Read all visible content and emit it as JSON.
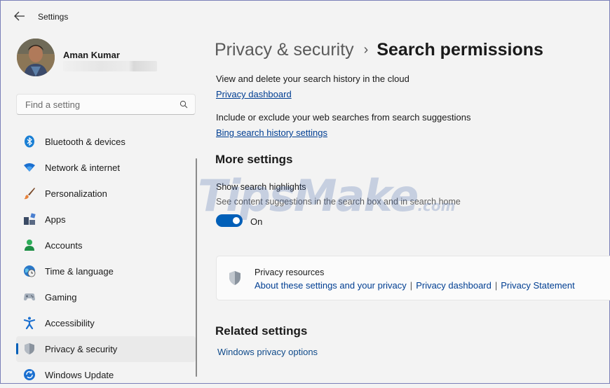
{
  "window": {
    "title": "Settings"
  },
  "profile": {
    "name": "Aman Kumar"
  },
  "search": {
    "placeholder": "Find a setting"
  },
  "sidebar": {
    "items": [
      {
        "label": "Bluetooth & devices",
        "icon": "bluetooth-icon"
      },
      {
        "label": "Network & internet",
        "icon": "wifi-icon"
      },
      {
        "label": "Personalization",
        "icon": "brush-icon"
      },
      {
        "label": "Apps",
        "icon": "apps-icon"
      },
      {
        "label": "Accounts",
        "icon": "person-icon"
      },
      {
        "label": "Time & language",
        "icon": "globe-clock-icon"
      },
      {
        "label": "Gaming",
        "icon": "gamepad-icon"
      },
      {
        "label": "Accessibility",
        "icon": "accessibility-icon"
      },
      {
        "label": "Privacy & security",
        "icon": "shield-icon",
        "active": true
      },
      {
        "label": "Windows Update",
        "icon": "update-icon"
      }
    ]
  },
  "breadcrumb": {
    "parent": "Privacy & security",
    "separator": "›",
    "current": "Search permissions"
  },
  "main": {
    "history_text": "View and delete your search history in the cloud",
    "privacy_dashboard_link": "Privacy dashboard",
    "web_searches_text": "Include or exclude your web searches from search suggestions",
    "bing_link": "Bing search history settings",
    "more_settings_heading": "More settings",
    "highlights_title": "Show search highlights",
    "highlights_desc": "See content suggestions in the search box and in search home",
    "toggle_state": "On",
    "resources": {
      "title": "Privacy resources",
      "links": [
        "About these settings and your privacy",
        "Privacy dashboard",
        "Privacy Statement"
      ],
      "separator": "|"
    },
    "related_heading": "Related settings",
    "related_link": "Windows privacy options"
  },
  "watermark": {
    "text": "TipsMake",
    "suffix": ".com"
  },
  "colors": {
    "accent": "#005fb8",
    "link": "#003e92",
    "background": "#f3f3f3"
  }
}
